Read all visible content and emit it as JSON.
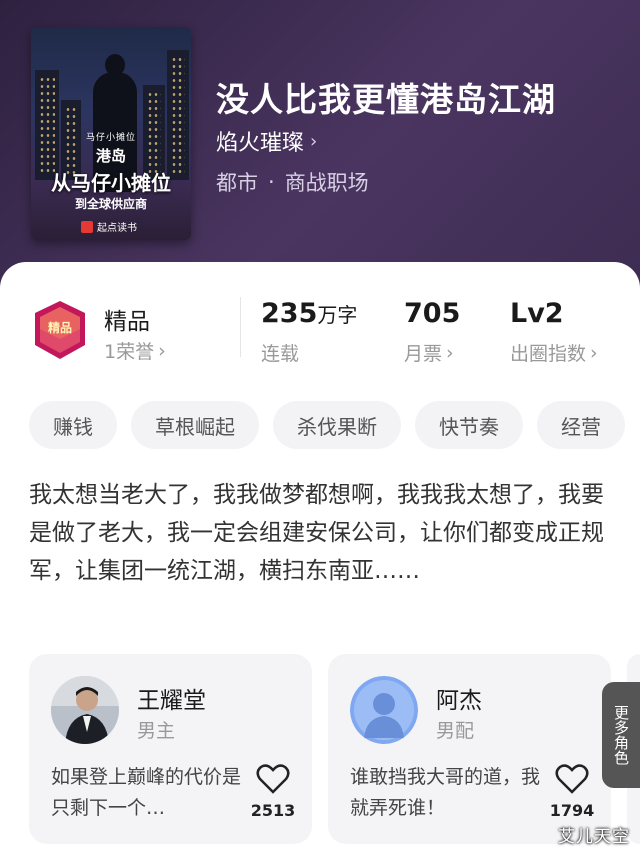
{
  "book": {
    "title": "没人比我更懂港岛江湖",
    "author": "焰火璀璨",
    "genre_main": "都市",
    "genre_sep": "·",
    "genre_sub": "商战职场"
  },
  "cover": {
    "small_text": "马仔小摊位",
    "line1": "港岛",
    "line2": "从马仔小摊位",
    "line3": "到全球供应商",
    "publisher": "起点读书"
  },
  "stats": {
    "badge_label": "精品",
    "badge_text": "精品",
    "honor": "1荣誉",
    "words_value": "235",
    "words_unit": "万字",
    "status": "连载",
    "tickets_value": "705",
    "tickets_label": "月票",
    "level_value": "Lv2",
    "level_label": "出圈指数"
  },
  "tags": [
    "赚钱",
    "草根崛起",
    "杀伐果断",
    "快节奏",
    "经营"
  ],
  "intro": "我太想当老大了，我我做梦都想啊，我我我太想了，我要是做了老大，我一定会组建安保公司，让你们都变成正规军，让集团一统江湖，横扫东南亚……",
  "characters": [
    {
      "name": "王耀堂",
      "role": "男主",
      "quote": "如果登上巅峰的代价是只剩下一个…",
      "likes": "2513"
    },
    {
      "name": "阿杰",
      "role": "男配",
      "quote": "谁敢挡我大哥的道，我就弄死谁！",
      "likes": "1794"
    }
  ],
  "more_roles": "更多角色",
  "watermark": "艾儿天空",
  "colors": {
    "hero_bg": "#3d2c52",
    "card_bg": "#ffffff",
    "tag_bg": "#f3f3f5",
    "char_bg": "#f4f4f6"
  }
}
